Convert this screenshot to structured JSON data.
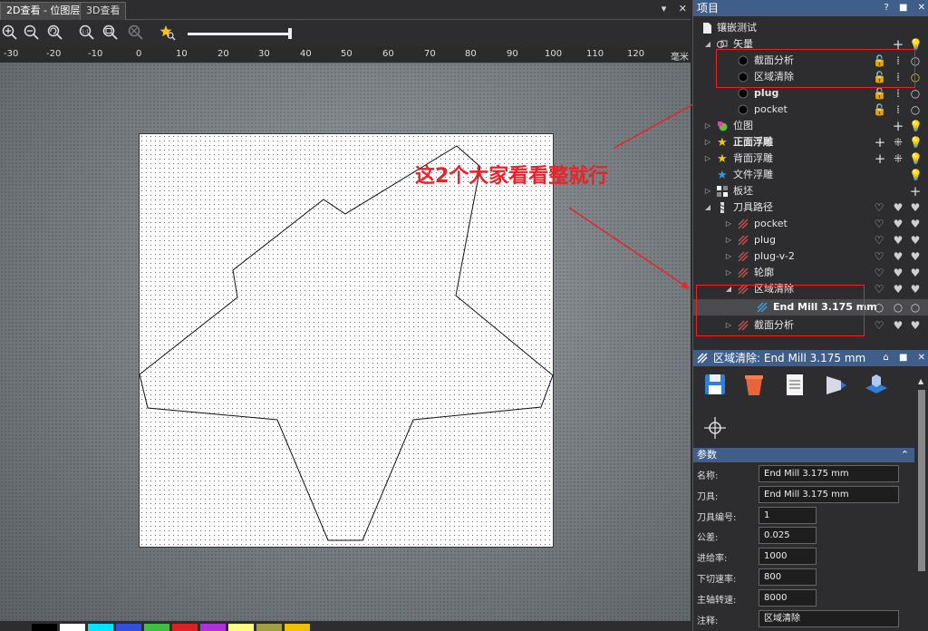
{
  "tabs": [
    {
      "label": "2D查看 - 位图层",
      "active": true
    },
    {
      "label": "3D查看",
      "active": false
    }
  ],
  "tab_controls": {
    "dropdown": "▾",
    "close": "✕"
  },
  "ruler": {
    "ticks": [
      "-30",
      "-20",
      "-10",
      "0",
      "10",
      "20",
      "30",
      "40",
      "50",
      "60",
      "70",
      "80",
      "90",
      "100",
      "110",
      "120"
    ],
    "unit": "毫米"
  },
  "annotation": {
    "text": "这2个大家看看整就行",
    "color": "#e8232a"
  },
  "palette": [
    "#000000",
    "#ffffff",
    "#00e5ff",
    "#3050e0",
    "#40c040",
    "#e02020",
    "#b030e0",
    "#ffff80",
    "#a0a040",
    "#f0c000"
  ],
  "project": {
    "title": "项目",
    "controls": [
      "?",
      "■",
      "✕"
    ],
    "tree": [
      {
        "label": "镶嵌测试",
        "level": 0,
        "icon": "page-icon"
      },
      {
        "label": "矢量",
        "level": 1,
        "icon": "vector-icon",
        "expanded": true
      },
      {
        "label": "截面分析",
        "level": 2,
        "icon": "dot-icon"
      },
      {
        "label": "区域清除",
        "level": 2,
        "icon": "dot-icon"
      },
      {
        "label": "plug",
        "level": 2,
        "icon": "dot-icon",
        "bold": true
      },
      {
        "label": "pocket",
        "level": 2,
        "icon": "dot-icon"
      },
      {
        "label": "位图",
        "level": 1,
        "icon": "bitmap-icon"
      },
      {
        "label": "正面浮雕",
        "level": 1,
        "icon": "star-icon",
        "bold": true
      },
      {
        "label": "背面浮雕",
        "level": 1,
        "icon": "star-icon"
      },
      {
        "label": "文件浮雕",
        "level": 1,
        "icon": "star-blue-icon"
      },
      {
        "label": "板坯",
        "level": 1,
        "icon": "block-icon"
      },
      {
        "label": "刀具路径",
        "level": 1,
        "icon": "tool-icon",
        "expanded": true
      },
      {
        "label": "pocket",
        "level": 2,
        "icon": "toolpath-icon"
      },
      {
        "label": "plug",
        "level": 2,
        "icon": "toolpath-icon"
      },
      {
        "label": "plug-v-2",
        "level": 2,
        "icon": "toolpath-icon"
      },
      {
        "label": "轮廓",
        "level": 2,
        "icon": "toolpath-icon"
      },
      {
        "label": "区域清除",
        "level": 2,
        "icon": "toolpath-icon",
        "expanded": true
      },
      {
        "label": "End Mill 3.175 mm",
        "level": 3,
        "icon": "endmill-icon",
        "bold": true
      },
      {
        "label": "截面分析",
        "level": 2,
        "icon": "toolpath-icon"
      }
    ]
  },
  "tool_panel": {
    "title": "区域清除: End Mill 3.175 mm",
    "controls": [
      "⌂",
      "■",
      "✕"
    ],
    "params_title": "参数",
    "params": [
      {
        "label": "名称:",
        "value": "End Mill 3.175 mm"
      },
      {
        "label": "刀具:",
        "value": "End Mill 3.175 mm"
      },
      {
        "label": "刀具编号:",
        "value": "1"
      },
      {
        "label": "公差:",
        "value": "0.025"
      },
      {
        "label": "进给率:",
        "value": "1000"
      },
      {
        "label": "下切速率:",
        "value": "800"
      },
      {
        "label": "主轴转速:",
        "value": "8000"
      },
      {
        "label": "注释:",
        "value": "区域清除"
      }
    ]
  }
}
